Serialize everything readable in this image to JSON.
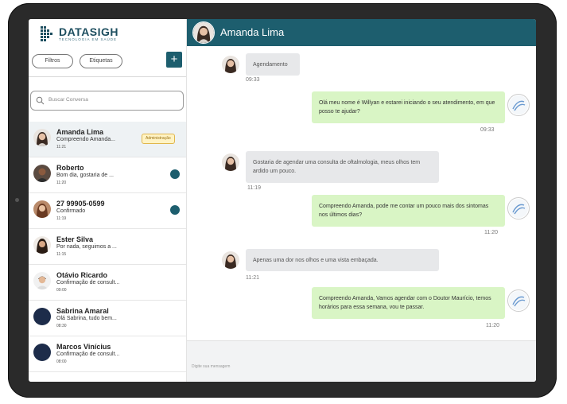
{
  "brand": {
    "name": "DATASIGH",
    "tagline": "TECNOLOGIA EM SAÚDE",
    "color": "#1d4e5f"
  },
  "sidebar": {
    "filters_label": "Filtros",
    "tags_label": "Etiquetas",
    "add_label": "+",
    "search_placeholder": "Buscar Conversa",
    "conversations": [
      {
        "name": "Amanda Lima",
        "preview": "Compreendo Amanda...",
        "time": "11:21",
        "tag": "Administração"
      },
      {
        "name": "Roberto",
        "preview": "Bom dia, gostaria de ...",
        "time": "11:20",
        "unread": true
      },
      {
        "name": "27 99905-0599",
        "preview": "Confirmado",
        "time": "11:19",
        "unread": true
      },
      {
        "name": "Ester Silva",
        "preview": "Por nada, seguimos a ...",
        "time": "11:15"
      },
      {
        "name": "Otávio Ricardo",
        "preview": "Confirmação de consult...",
        "time": "09:00"
      },
      {
        "name": "Sabrina Amaral",
        "preview": "Olá Sabrina, tudo bem...",
        "time": "08:30"
      },
      {
        "name": "Marcos Vinícius",
        "preview": "Confirmação de consult...",
        "time": "08:00"
      }
    ]
  },
  "chat": {
    "title": "Amanda Lima",
    "accent": "#1d5e6e",
    "messages": [
      {
        "dir": "in",
        "text": "Agendamento",
        "time": "09:33"
      },
      {
        "dir": "out",
        "text": "Olá meu nome é Willyan e estarei iniciando o seu atendimento, em que posso te ajudar?",
        "time": "09:33"
      },
      {
        "dir": "in",
        "text": "Gostaria de agendar uma consulta de oftalmologia, meus olhos tem ardido um pouco.",
        "time": "11:19"
      },
      {
        "dir": "out",
        "text": "Compreendo Amanda, pode me contar um pouco mais dos sintomas nos últimos dias?",
        "time": "11:20"
      },
      {
        "dir": "in",
        "text": "Apenas uma dor nos olhos e uma vista embaçada.",
        "time": "11:21"
      },
      {
        "dir": "out",
        "text": "Compreendo Amanda, Vamos agendar com o Doutor Maurício, temos horários para essa semana, vou te passar.",
        "time": "11:20"
      }
    ],
    "composer_placeholder": "Digite sua mensagem"
  }
}
